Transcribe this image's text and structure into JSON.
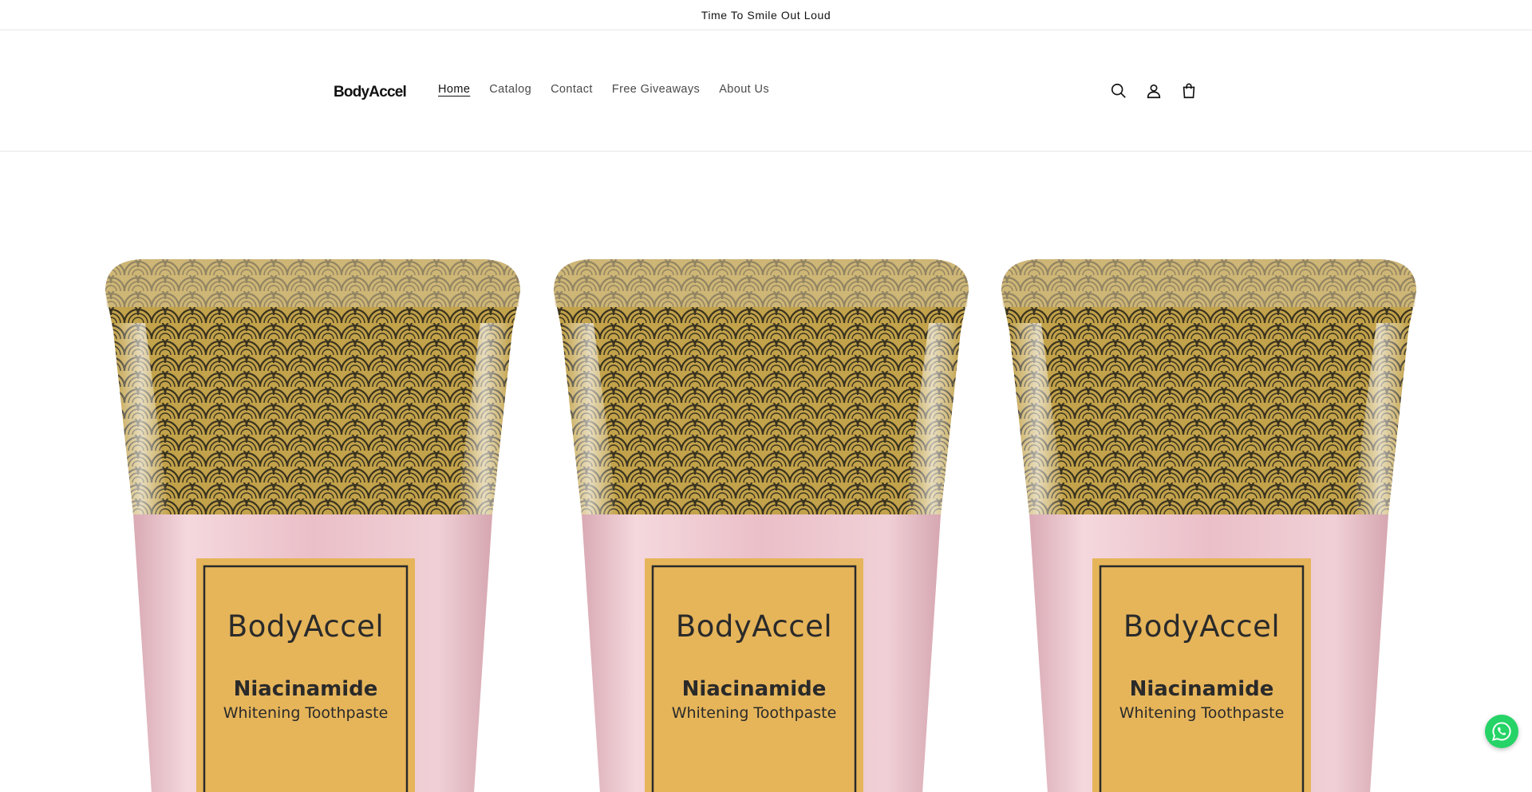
{
  "announcement": {
    "text": "Time To Smile Out Loud"
  },
  "header": {
    "logo": "BodyAccel",
    "nav": [
      {
        "label": "Home",
        "active": true
      },
      {
        "label": "Catalog",
        "active": false
      },
      {
        "label": "Contact",
        "active": false
      },
      {
        "label": "Free Giveaways",
        "active": false
      },
      {
        "label": "About Us",
        "active": false
      }
    ],
    "icons": [
      "search-icon",
      "account-icon",
      "cart-icon"
    ]
  },
  "products": {
    "items": [
      {
        "brand": "BodyAccel",
        "ingredient": "Niacinamide",
        "product": "Whitening Toothpaste"
      },
      {
        "brand": "BodyAccel",
        "ingredient": "Niacinamide",
        "product": "Whitening Toothpaste"
      },
      {
        "brand": "BodyAccel",
        "ingredient": "Niacinamide",
        "product": "Whitening Toothpaste"
      }
    ]
  },
  "colors": {
    "tube_gold": "#b99a3e",
    "tube_pink": "#ebbfc8",
    "label_gold": "#e6b55a",
    "whatsapp_green": "#25d366"
  },
  "floating": {
    "chat_icon": "whatsapp-icon"
  }
}
